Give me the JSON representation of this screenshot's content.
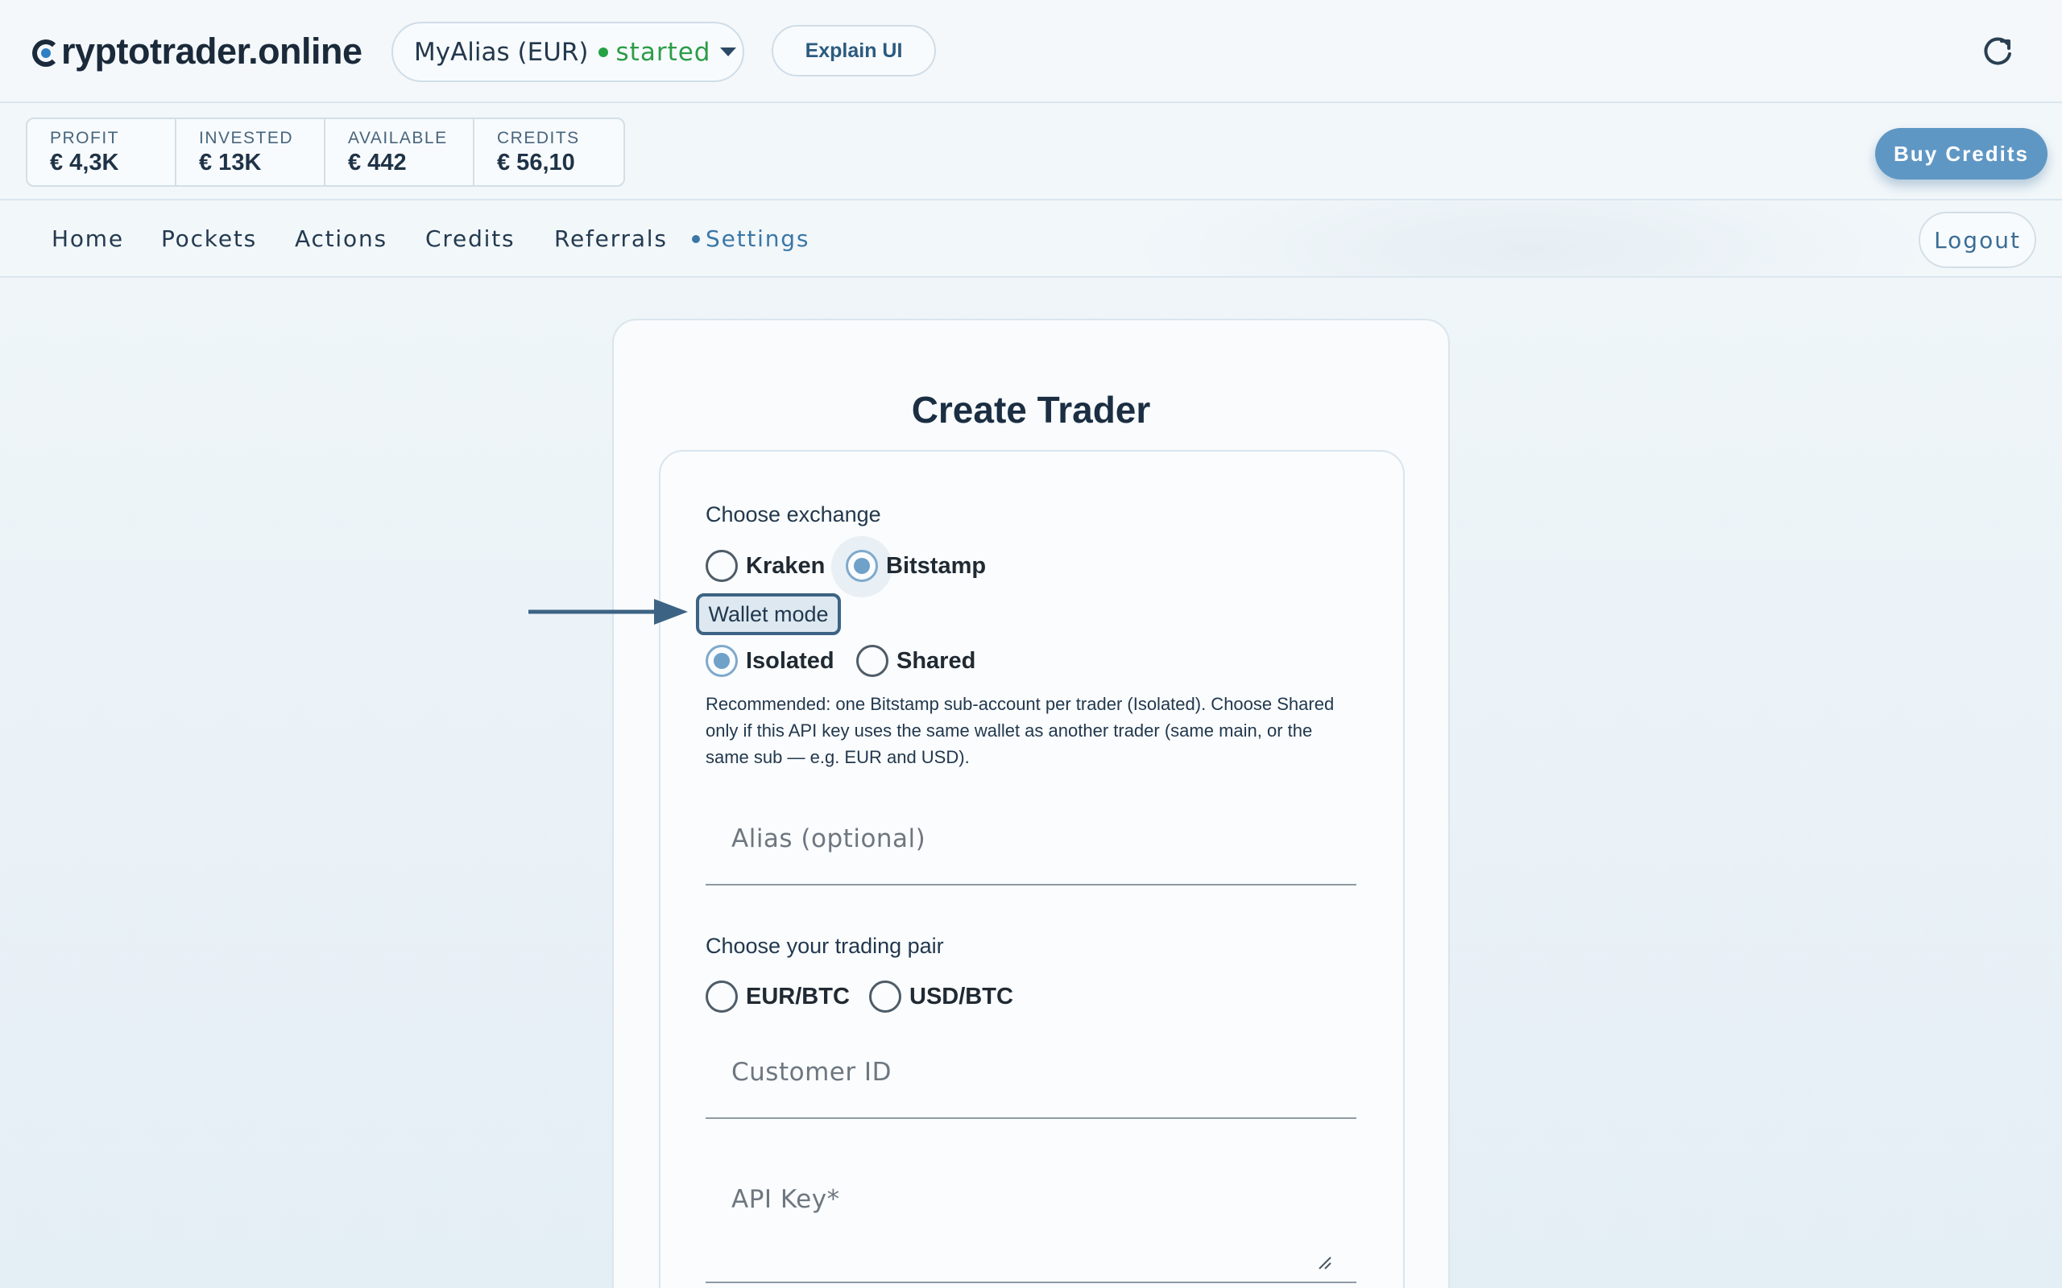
{
  "header": {
    "logo_rest": "ryptotrader.online",
    "trader_select": {
      "alias": "MyAlias (EUR)",
      "status": "started"
    },
    "explain_label": "Explain UI"
  },
  "stats": [
    {
      "label": "PROFIT",
      "value": "€ 4,3K"
    },
    {
      "label": "INVESTED",
      "value": "€ 13K"
    },
    {
      "label": "AVAILABLE",
      "value": "€ 442"
    },
    {
      "label": "CREDITS",
      "value": "€ 56,10"
    }
  ],
  "buy_credits_label": "Buy Credits",
  "nav": {
    "items": [
      "Home",
      "Pockets",
      "Actions",
      "Credits",
      "Referrals",
      "Settings"
    ],
    "active": "Settings",
    "logout_label": "Logout"
  },
  "form": {
    "title": "Create Trader",
    "exchange": {
      "label": "Choose exchange",
      "options": [
        "Kraken",
        "Bitstamp"
      ],
      "selected": "Bitstamp"
    },
    "wallet_mode": {
      "label": "Wallet mode",
      "options": [
        "Isolated",
        "Shared"
      ],
      "selected": "Isolated",
      "help": "Recommended: one Bitstamp sub-account per trader (Isolated). Choose Shared only if this API key uses the same wallet as another trader (same main, or the same sub — e.g. EUR and USD)."
    },
    "alias_placeholder": "Alias (optional)",
    "pair": {
      "label": "Choose your trading pair",
      "options": [
        "EUR/BTC",
        "USD/BTC"
      ],
      "selected": ""
    },
    "customer_id_placeholder": "Customer ID",
    "api_key_placeholder": "API Key*"
  },
  "colors": {
    "accent": "#3b77a6",
    "status_green": "#2c9c48",
    "button_blue": "#5f97c4",
    "highlight_border": "#3d6384"
  }
}
